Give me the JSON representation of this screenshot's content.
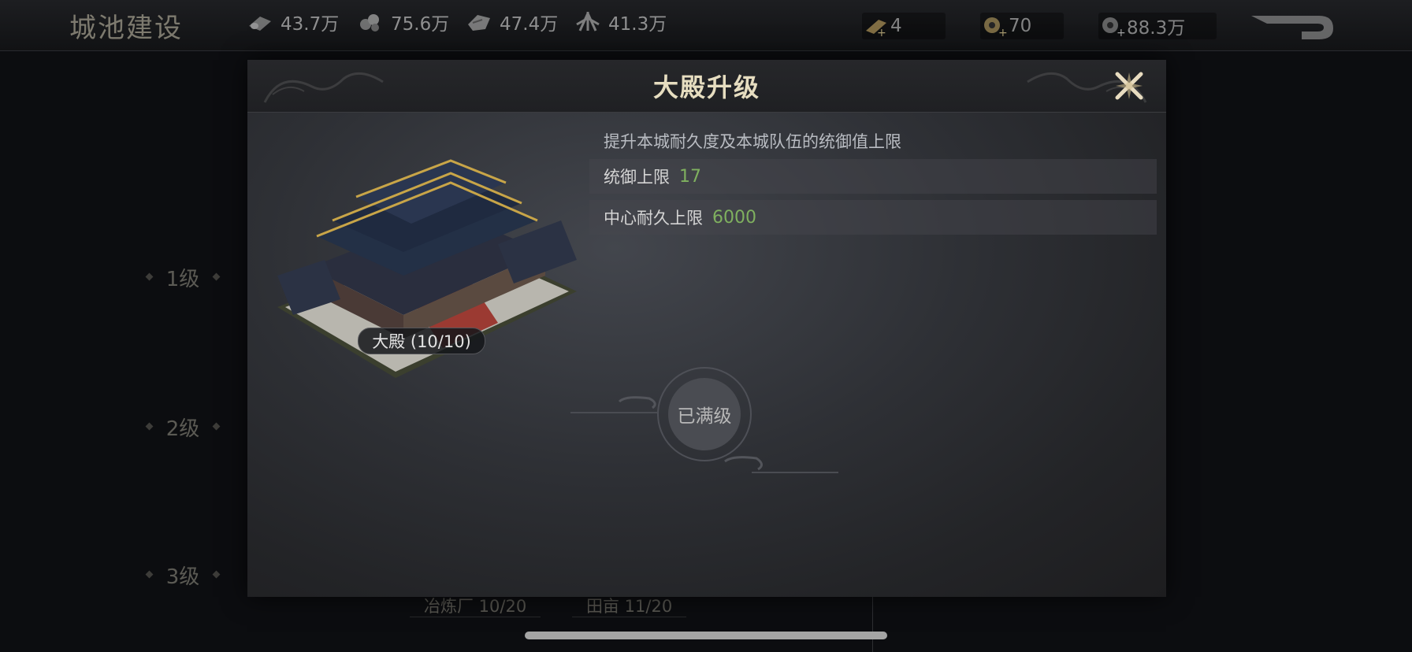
{
  "header": {
    "title": "城池建设",
    "resources": [
      {
        "icon": "wood-icon",
        "value": "43.7万"
      },
      {
        "icon": "iron-icon",
        "value": "75.6万"
      },
      {
        "icon": "stone-icon",
        "value": "47.4万"
      },
      {
        "icon": "grain-icon",
        "value": "41.3万"
      }
    ],
    "currencies": [
      {
        "icon": "gold-bar-icon",
        "value": "4"
      },
      {
        "icon": "jade-coin-icon",
        "value": "70"
      },
      {
        "icon": "copper-coin-icon",
        "value": "88.3万"
      }
    ]
  },
  "background": {
    "levels": [
      "1级",
      "2级",
      "3级"
    ],
    "tags": [
      "冶炼厂 10/20",
      "田亩 11/20"
    ]
  },
  "modal": {
    "title": "大殿升级",
    "description": "提升本城耐久度及本城队伍的统御值上限",
    "stats": [
      {
        "label": "统御上限",
        "value": "17"
      },
      {
        "label": "中心耐久上限",
        "value": "6000"
      }
    ],
    "building_label": "大殿 (10/10)",
    "max_label": "已满级"
  },
  "colors": {
    "stat_value": "#7fb05f",
    "title": "#e6ddc0"
  }
}
